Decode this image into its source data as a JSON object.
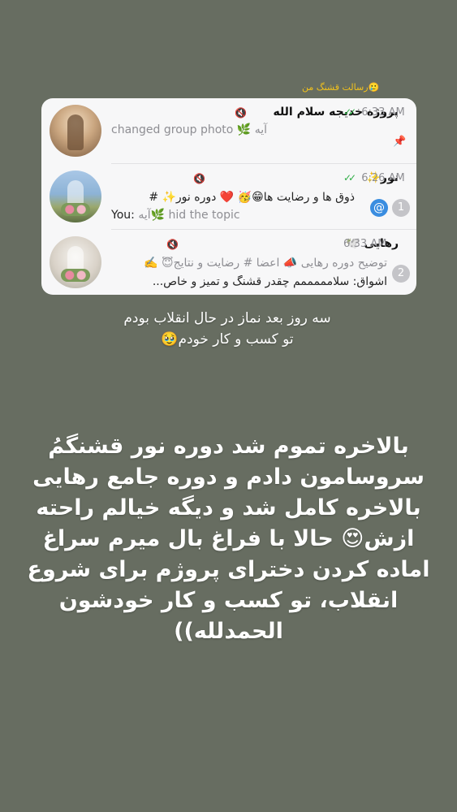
{
  "caption_top": "رسالت قشنگ من🥲",
  "chats": [
    {
      "title": "پروژه خدیجه سلام الله",
      "time": "6:33 AM",
      "read": "✓✓",
      "muted_icon": "🔇",
      "line1": "changed group photo 🌿 آیه",
      "line2": "",
      "pin": "📌",
      "badge": ""
    },
    {
      "title": "نور✨",
      "time": "6:26 AM",
      "read": "✓✓",
      "muted_icon": "🔇",
      "line1": "ذوق ها و رضایت ها😁🥳 ❤️ دوره نور✨ #",
      "line2_prefix": "You:",
      "line2": "آیه🌿  hid the topic",
      "mention": "@",
      "badge": "1"
    },
    {
      "title": "رهایی 🕊️",
      "time": "6:33 AM",
      "read": "",
      "muted_icon": "🔇",
      "line1": "توضیح دوره رهایی 📣 اعضا # رضایت و نتایج😇 ✍️",
      "line2": "اشواق: سلامممممم چقدر قشنگ و تمیز و خاص...",
      "badge": "2"
    }
  ],
  "story_small": "سه روز بعد نماز در حال انقلاب بودم تو کسب و کار خودم🥹",
  "story_big": "بالاخره تموم شد دوره نور قشنگمُ سروسامون دادم و دوره جامع رهایی بالاخره کامل شد و دیگه خیالم راحته ازش😍 حالا با فراغ بال میرم سراغ اماده کردن دخترای پروژم برای شروع انقلاب، تو کسب و کار خودشون الحمدلله))"
}
